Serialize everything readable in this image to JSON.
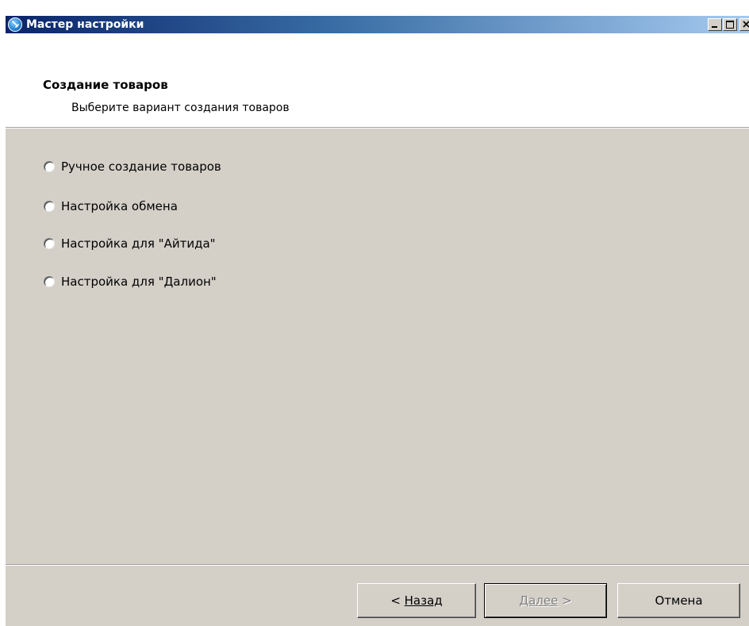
{
  "window": {
    "title": "Мастер настройки",
    "title_gradient": [
      "#0a246a",
      "#a6caf0"
    ],
    "icon": "app-wizard-icon"
  },
  "header": {
    "title": "Создание товаров",
    "subtitle": "Выберите вариант создания товаров"
  },
  "options": [
    {
      "label": "Ручное создание товаров",
      "selected": false
    },
    {
      "label": "Настройка обмена",
      "selected": false
    },
    {
      "label": "Настройка для \"Айтида\"",
      "selected": false
    },
    {
      "label": "Настройка для \"Далион\"",
      "selected": false
    }
  ],
  "buttons": {
    "back": {
      "prefix": "< ",
      "label": "Назад"
    },
    "next": {
      "label": "Далее",
      "suffix": " >",
      "enabled": false
    },
    "cancel": {
      "label": "Отмена"
    }
  }
}
